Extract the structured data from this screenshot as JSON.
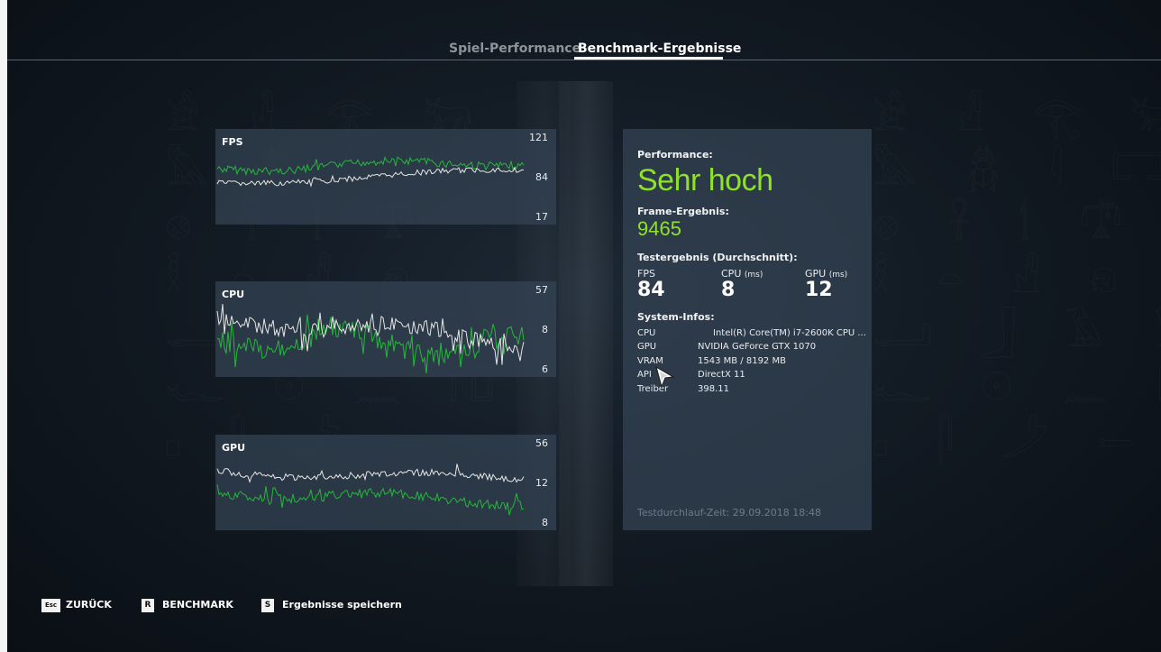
{
  "tabs": [
    {
      "label": "Spiel-Performance",
      "active": false
    },
    {
      "label": "Benchmark-Ergebnisse",
      "active": true
    }
  ],
  "graphs": {
    "fps": {
      "label": "FPS",
      "ticks": [
        "121",
        "84",
        "17"
      ]
    },
    "cpu": {
      "label": "CPU",
      "ticks": [
        "57",
        "8",
        "6"
      ]
    },
    "gpu": {
      "label": "GPU",
      "ticks": [
        "56",
        "12",
        "8"
      ]
    }
  },
  "colors": {
    "accent": "#8fe22a",
    "graph_green": "#25b83a",
    "graph_white": "#e6e6e6"
  },
  "info": {
    "performance_label": "Performance:",
    "performance_value": "Sehr hoch",
    "frame_label": "Frame-Ergebnis:",
    "frame_value": "9465",
    "test_label": "Testergebnis (Durchschnitt):",
    "stats": [
      {
        "name": "FPS",
        "unit": "",
        "value": "84"
      },
      {
        "name": "CPU",
        "unit": "(ms)",
        "value": "8"
      },
      {
        "name": "GPU",
        "unit": "(ms)",
        "value": "12"
      }
    ],
    "system_label": "System-Infos:",
    "system": [
      {
        "key": "CPU",
        "value": "Intel(R) Core(TM) i7-2600K CPU ..."
      },
      {
        "key": "GPU",
        "value": "NVIDIA GeForce GTX 1070"
      },
      {
        "key": "VRAM",
        "value": "1543 MB / 8192 MB"
      },
      {
        "key": "API",
        "value": "DirectX 11"
      },
      {
        "key": "Treiber",
        "value": "398.11"
      }
    ],
    "test_time": "Testdurchlauf-Zeit: 29.09.2018 18:48"
  },
  "footer": [
    {
      "key": "Esc",
      "label": "ZURÜCK"
    },
    {
      "key": "R",
      "label": "BENCHMARK"
    },
    {
      "key": "S",
      "label": "Ergebnisse speichern"
    }
  ],
  "icons": {
    "cursor": "mouse-cursor-icon"
  }
}
